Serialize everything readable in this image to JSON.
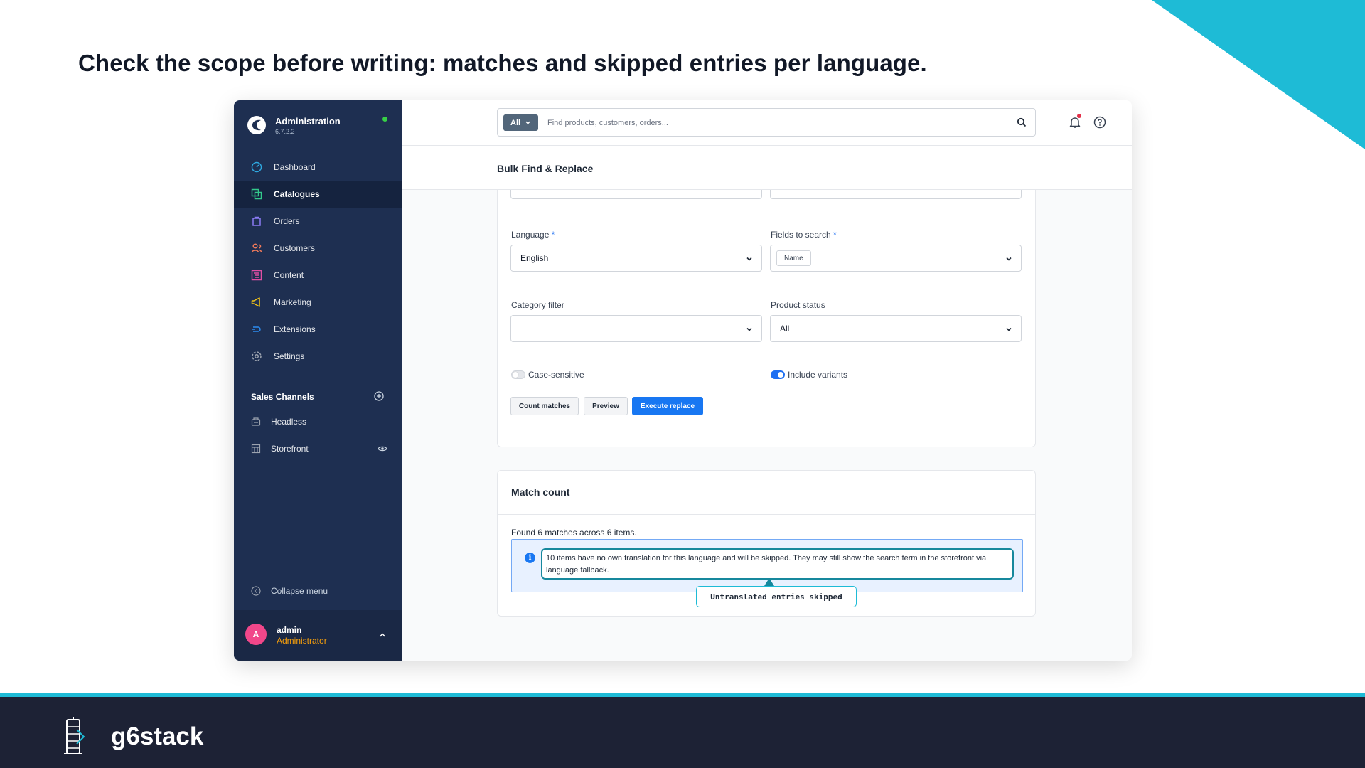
{
  "slide": {
    "headline": "Check the scope before writing: matches and skipped entries per language.",
    "accent_color": "#1ebbd6",
    "footer_brand": "g6stack"
  },
  "app": {
    "brand_title": "Administration",
    "version": "6.7.2.2",
    "status": "online"
  },
  "sidebar": {
    "items": [
      {
        "label": "Dashboard",
        "icon": "dashboard-icon",
        "active": false
      },
      {
        "label": "Catalogues",
        "icon": "catalogues-icon",
        "active": true
      },
      {
        "label": "Orders",
        "icon": "orders-icon",
        "active": false
      },
      {
        "label": "Customers",
        "icon": "customers-icon",
        "active": false
      },
      {
        "label": "Content",
        "icon": "content-icon",
        "active": false
      },
      {
        "label": "Marketing",
        "icon": "marketing-icon",
        "active": false
      },
      {
        "label": "Extensions",
        "icon": "extensions-icon",
        "active": false
      },
      {
        "label": "Settings",
        "icon": "settings-icon",
        "active": false
      }
    ],
    "sales_channels_title": "Sales Channels",
    "channels": [
      {
        "label": "Headless",
        "icon": "headless-icon"
      },
      {
        "label": "Storefront",
        "icon": "storefront-icon"
      }
    ],
    "collapse_label": "Collapse menu",
    "user": {
      "initial": "A",
      "name": "admin",
      "role": "Administrator"
    }
  },
  "topbar": {
    "search_scope": "All",
    "search_placeholder": "Find products, customers, orders..."
  },
  "page": {
    "title": "Bulk Find & Replace"
  },
  "form": {
    "language_label": "Language",
    "language_value": "English",
    "fields_label": "Fields to search",
    "fields_chip": "Name",
    "required_mark": "*",
    "category_label": "Category filter",
    "category_value": "",
    "status_label": "Product status",
    "status_value": "All",
    "case_sensitive_label": "Case-sensitive",
    "case_sensitive_on": false,
    "include_variants_label": "Include variants",
    "include_variants_on": true,
    "count_button": "Count matches",
    "preview_button": "Preview",
    "execute_button": "Execute replace"
  },
  "match_count": {
    "title": "Match count",
    "summary": "Found 6 matches across 6 items.",
    "alert_text": "10 items have no own translation for this language and will be skipped. They may still show the search term in the storefront via language fallback.",
    "tooltip": "Untranslated entries skipped"
  }
}
